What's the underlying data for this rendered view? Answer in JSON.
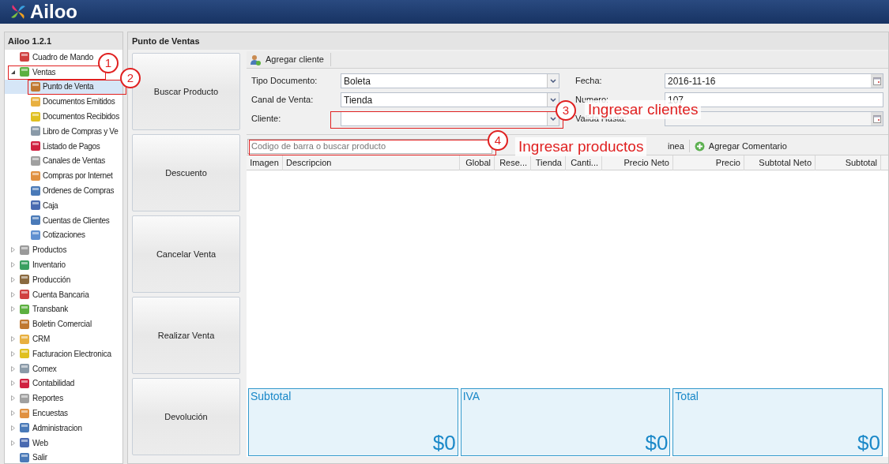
{
  "app": {
    "logo_text": "Ailoo"
  },
  "sidebar": {
    "title": "Ailoo 1.2.1",
    "items": [
      {
        "label": "Cuadro de Mando",
        "kind": "leaf"
      },
      {
        "label": "Ventas",
        "kind": "group",
        "expanded": true,
        "children": [
          {
            "label": "Punto de Venta",
            "selected": true
          },
          {
            "label": "Documentos Emitidos",
            "selected": false
          },
          {
            "label": "Documentos Recibidos",
            "selected": false
          },
          {
            "label": "Libro de Compras y Ve",
            "selected": false
          },
          {
            "label": "Listado de Pagos",
            "selected": false
          },
          {
            "label": "Canales de Ventas",
            "selected": false
          },
          {
            "label": "Compras por Internet",
            "selected": false
          },
          {
            "label": "Ordenes de Compras",
            "selected": false
          },
          {
            "label": "Caja",
            "selected": false
          },
          {
            "label": "Cuentas de Clientes",
            "selected": false
          },
          {
            "label": "Cotizaciones",
            "selected": false
          }
        ]
      },
      {
        "label": "Productos",
        "kind": "group",
        "expanded": false
      },
      {
        "label": "Inventario",
        "kind": "group",
        "expanded": false
      },
      {
        "label": "Producción",
        "kind": "group",
        "expanded": false
      },
      {
        "label": "Cuenta Bancaria",
        "kind": "group",
        "expanded": false
      },
      {
        "label": "Transbank",
        "kind": "group",
        "expanded": false
      },
      {
        "label": "Boletin Comercial",
        "kind": "leaf"
      },
      {
        "label": "CRM",
        "kind": "group",
        "expanded": false
      },
      {
        "label": "Facturacion Electronica",
        "kind": "group",
        "expanded": false
      },
      {
        "label": "Comex",
        "kind": "group",
        "expanded": false
      },
      {
        "label": "Contabilidad",
        "kind": "group",
        "expanded": false
      },
      {
        "label": "Reportes",
        "kind": "group",
        "expanded": false
      },
      {
        "label": "Encuestas",
        "kind": "group",
        "expanded": false
      },
      {
        "label": "Administracion",
        "kind": "group",
        "expanded": false
      },
      {
        "label": "Web",
        "kind": "group",
        "expanded": false
      },
      {
        "label": "Salir",
        "kind": "leaf"
      }
    ]
  },
  "main": {
    "title": "Punto de Ventas",
    "actions": [
      "Buscar Producto",
      "Descuento",
      "Cancelar Venta",
      "Realizar Venta",
      "Devolución"
    ],
    "toolbar": {
      "button": "Agregar cliente"
    },
    "form_left": [
      {
        "label": "Tipo Documento:",
        "value": "Boleta"
      },
      {
        "label": "Canal de Venta:",
        "value": "Tienda"
      },
      {
        "label": "Cliente:"
      }
    ],
    "form_right": [
      {
        "label": "Fecha:",
        "value": "2016-11-16",
        "kind": "date"
      },
      {
        "label": "Numero:",
        "value": "107",
        "kind": "text"
      },
      {
        "label": "Valida Hasta:",
        "kind": "date",
        "disabled": true
      }
    ],
    "search": {
      "placeholder": "Codigo de barra o buscar producto"
    },
    "line_toolbar": [
      "inea",
      "Agregar Comentario"
    ],
    "table": {
      "columns": [
        "Imagen",
        "Descripcion",
        "Global",
        "Rese...",
        "Tienda",
        "Canti...",
        "Precio Neto",
        "Precio",
        "Subtotal Neto",
        "Subtotal"
      ]
    },
    "totals": [
      {
        "label": "Subtotal",
        "value": "$0"
      },
      {
        "label": "IVA",
        "value": "$0"
      },
      {
        "label": "Total",
        "value": "$0"
      }
    ]
  },
  "annotations": [
    {
      "number": "1"
    },
    {
      "number": "2"
    },
    {
      "number": "3",
      "label": "Ingresar clientes"
    },
    {
      "number": "4",
      "label": "Ingresar productos"
    }
  ]
}
